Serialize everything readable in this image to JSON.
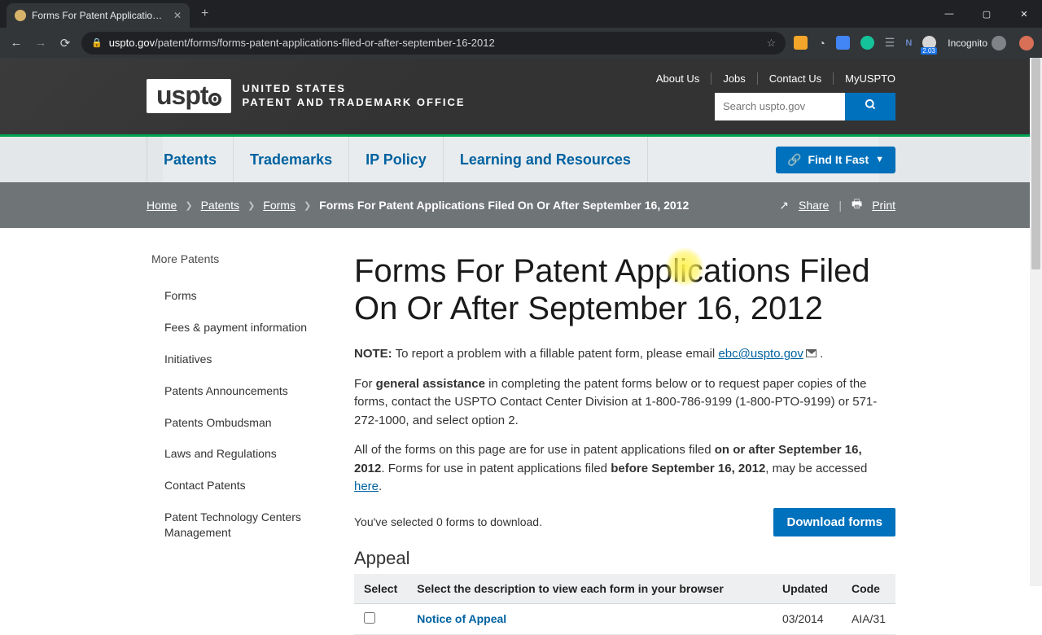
{
  "browser": {
    "tab_title": "Forms For Patent Applications Fil",
    "url_domain": "uspto.gov",
    "url_path": "/patent/forms/forms-patent-applications-filed-or-after-september-16-2012",
    "incognito_label": "Incognito",
    "ext_badge": "2.03"
  },
  "header": {
    "logo_mark": "uspto",
    "logo_line1": "UNITED STATES",
    "logo_line2": "PATENT AND TRADEMARK OFFICE",
    "util": [
      "About Us",
      "Jobs",
      "Contact Us",
      "MyUSPTO"
    ],
    "search_placeholder": "Search uspto.gov"
  },
  "nav": {
    "items": [
      "Patents",
      "Trademarks",
      "IP Policy",
      "Learning and Resources"
    ],
    "findit": "Find It Fast"
  },
  "crumbs": {
    "items": [
      "Home",
      "Patents",
      "Forms"
    ],
    "current": "Forms For Patent Applications Filed On Or After September 16, 2012",
    "share": "Share",
    "print": "Print"
  },
  "sidebar": {
    "title": "More Patents",
    "items": [
      "Forms",
      "Fees & payment information",
      "Initiatives",
      "Patents Announcements",
      "Patents Ombudsman",
      "Laws and Regulations",
      "Contact Patents",
      "Patent Technology Centers Management"
    ]
  },
  "main": {
    "title": "Forms For Patent Applications Filed On Or After September 16, 2012",
    "note_label": "NOTE:",
    "note_text": " To report a problem with a fillable patent form, please email ",
    "note_email": "ebc@uspto.gov",
    "note_tail": " .",
    "p2_a": "For ",
    "p2_b": "general assistance",
    "p2_c": " in completing the patent forms below or to request paper copies of the forms, contact the USPTO Contact Center Division at 1-800-786-9199 (1-800-PTO-9199) or 571-272-1000, and select option 2.",
    "p3_a": "All of the forms on this page are for use in patent applications filed ",
    "p3_b": "on or after September 16, 2012",
    "p3_c": ". Forms for use in patent applications filed ",
    "p3_d": "before September 16, 2012",
    "p3_e": ", may be accessed ",
    "p3_link": "here",
    "p3_f": ".",
    "selected_text": "You've selected 0 forms to download.",
    "download_btn": "Download forms",
    "section": "Appeal",
    "th_select": "Select",
    "th_desc": "Select the description to view each form in your browser",
    "th_updated": "Updated",
    "th_code": "Code",
    "rows": [
      {
        "desc": "Notice of Appeal",
        "updated": "03/2014",
        "code": "AIA/31"
      }
    ]
  }
}
